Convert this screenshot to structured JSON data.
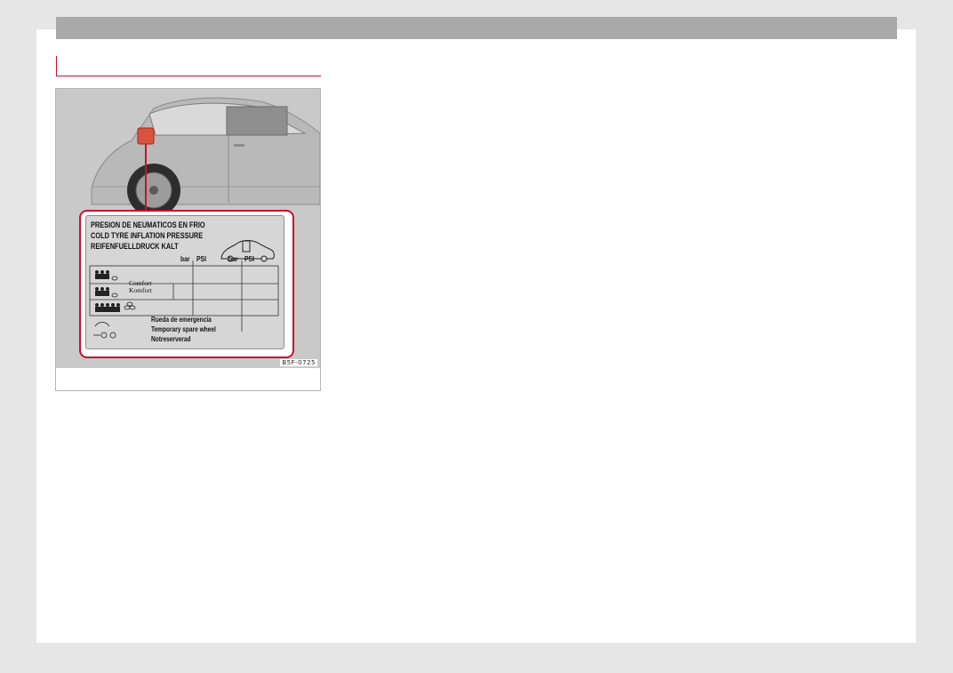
{
  "figure": {
    "code": "B5F-0725",
    "label": {
      "title_es": "PRESION DE NEUMATICOS EN FRIO",
      "title_en": "COLD TYRE INFLATION PRESSURE",
      "title_de": "REIFENFUELLDRUCK KALT",
      "units": [
        "bar",
        "PSI",
        "bar",
        "PSI"
      ],
      "comfort_en": "Comfort",
      "comfort_de": "Komfort",
      "spare_es": "Rueda de emergencia",
      "spare_en": "Temporary spare wheel",
      "spare_de": "Notreserverad"
    }
  },
  "colors": {
    "accent": "#c8102e",
    "bar": "#a9a9a9",
    "background": "#e6e6e6"
  }
}
